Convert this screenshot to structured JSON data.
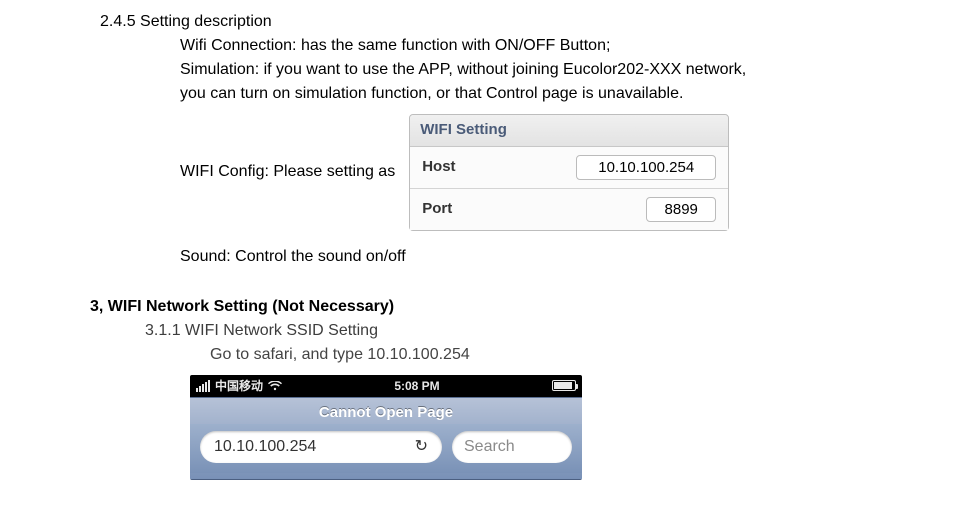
{
  "doc": {
    "heading245": "2.4.5 Setting description",
    "wifi_conn_line": "Wifi Connection: has the same function with ON/OFF Button;",
    "sim_line1": "Simulation: if you want to use the APP, without joining Eucolor202-XXX network,",
    "sim_line2": "you can turn on simulation function, or that Control page is unavailable.",
    "wifi_config_label": "WIFI Config: Please setting as",
    "sound_line": "Sound: Control the sound on/off",
    "sec3_heading": "3, WIFI Network Setting (Not Necessary)",
    "ssid_line": "3.1.1 WIFI Network SSID Setting",
    "go_line": "Go to safari, and type 10.10.100.254"
  },
  "wifi_panel": {
    "title": "WIFI Setting",
    "host_label": "Host",
    "host_value": "10.10.100.254",
    "port_label": "Port",
    "port_value": "8899"
  },
  "ios": {
    "carrier": "中国移动",
    "time": "5:08 PM",
    "page_title": "Cannot Open Page",
    "url": "10.10.100.254",
    "search_placeholder": "Search"
  }
}
